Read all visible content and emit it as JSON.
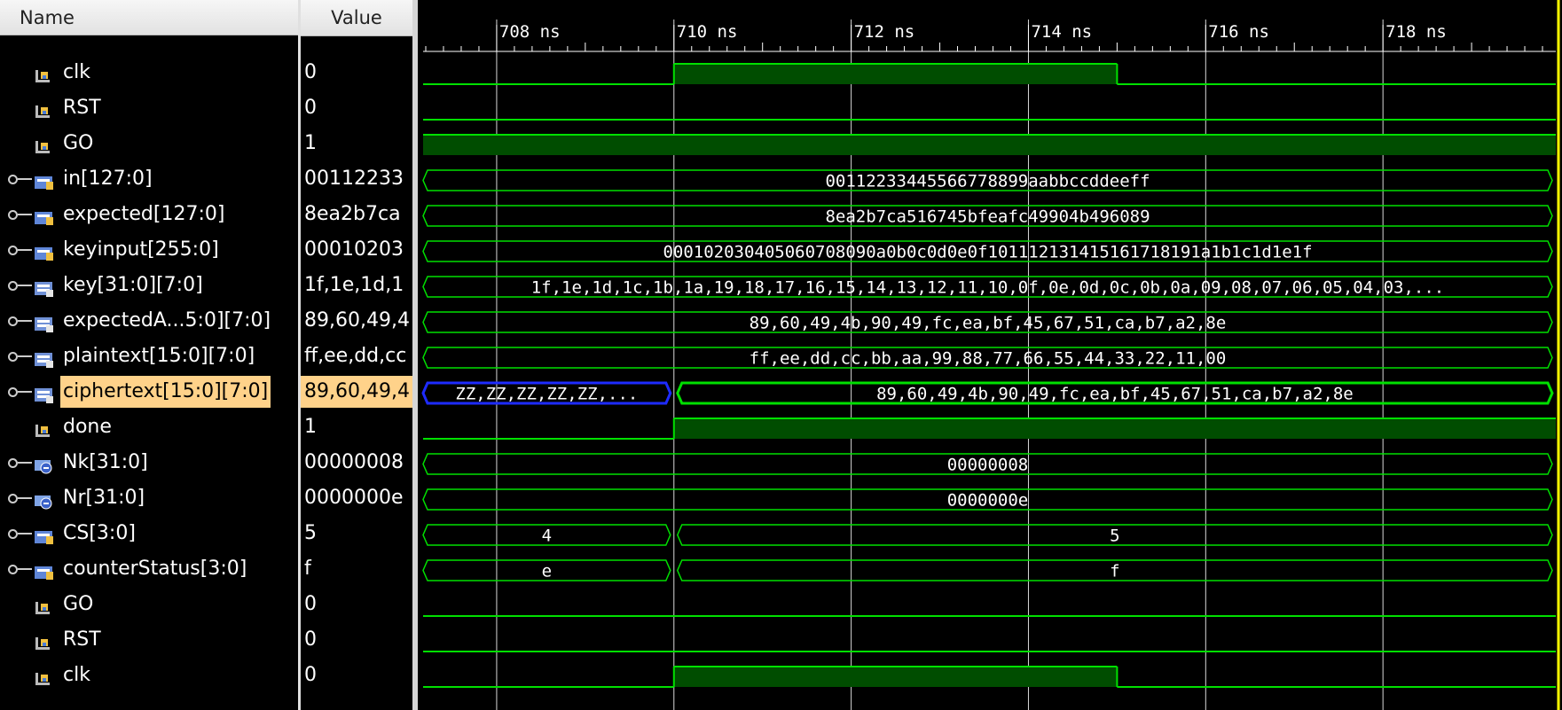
{
  "headers": {
    "name": "Name",
    "value": "Value"
  },
  "time_axis": {
    "ticks": [
      "708 ns",
      "710 ns",
      "712 ns",
      "714 ns",
      "716 ns",
      "718 ns"
    ],
    "tick_times_ns": [
      708,
      710,
      712,
      714,
      716,
      718
    ],
    "view_start_ns": 707.17,
    "view_end_ns": 719.95
  },
  "colors": {
    "trace": "#00e000",
    "fill": "#004d00",
    "trace_unknown": "#1e2bff",
    "cursor": "#ffff00",
    "grid": "#ffffff",
    "selection": "#ffd28a"
  },
  "signals": [
    {
      "name": "clk",
      "value": "0",
      "icon": "bit-signal-icon",
      "kind": "bit",
      "edges": [
        [
          707.17,
          0
        ],
        [
          710,
          1
        ],
        [
          715,
          0
        ]
      ]
    },
    {
      "name": "RST",
      "value": "0",
      "icon": "bit-signal-icon",
      "kind": "bit",
      "edges": [
        [
          707.17,
          0
        ]
      ]
    },
    {
      "name": "GO",
      "value": "1",
      "icon": "bit-signal-icon",
      "kind": "bit",
      "edges": [
        [
          707.17,
          1
        ]
      ]
    },
    {
      "name": "in[127:0]",
      "value": "00112233",
      "icon": "bus-signal-icon",
      "kind": "bus",
      "segments": [
        {
          "from": 707.17,
          "to": 719.95,
          "text": "00112233445566778899aabbccddeeff"
        }
      ]
    },
    {
      "name": "expected[127:0]",
      "value": "8ea2b7ca",
      "icon": "bus-signal-icon",
      "kind": "bus",
      "segments": [
        {
          "from": 707.17,
          "to": 719.95,
          "text": "8ea2b7ca516745bfeafc49904b496089"
        }
      ]
    },
    {
      "name": "keyinput[255:0]",
      "value": "00010203",
      "icon": "bus-signal-icon",
      "kind": "bus",
      "segments": [
        {
          "from": 707.17,
          "to": 719.95,
          "text": "000102030405060708090a0b0c0d0e0f101112131415161718191a1b1c1d1e1f"
        }
      ]
    },
    {
      "name": "key[31:0][7:0]",
      "value": "1f,1e,1d,1",
      "icon": "array-signal-icon",
      "kind": "bus",
      "segments": [
        {
          "from": 707.17,
          "to": 719.95,
          "text": "1f,1e,1d,1c,1b,1a,19,18,17,16,15,14,13,12,11,10,0f,0e,0d,0c,0b,0a,09,08,07,06,05,04,03,..."
        }
      ]
    },
    {
      "name": "expectedA...5:0][7:0]",
      "value": "89,60,49,4",
      "icon": "array-signal-icon",
      "kind": "bus",
      "segments": [
        {
          "from": 707.17,
          "to": 719.95,
          "text": "89,60,49,4b,90,49,fc,ea,bf,45,67,51,ca,b7,a2,8e"
        }
      ]
    },
    {
      "name": "plaintext[15:0][7:0]",
      "value": "ff,ee,dd,cc",
      "icon": "array-signal-icon",
      "kind": "bus",
      "segments": [
        {
          "from": 707.17,
          "to": 719.95,
          "text": "ff,ee,dd,cc,bb,aa,99,88,77,66,55,44,33,22,11,00"
        }
      ]
    },
    {
      "name": "ciphertext[15:0][7:0]",
      "value": "89,60,49,4",
      "icon": "array-signal-icon",
      "kind": "bus",
      "selected": true,
      "segments": [
        {
          "from": 707.17,
          "to": 710,
          "text": "ZZ,ZZ,ZZ,ZZ,ZZ,...",
          "unknown": true
        },
        {
          "from": 710,
          "to": 719.95,
          "text": "89,60,49,4b,90,49,fc,ea,bf,45,67,51,ca,b7,a2,8e"
        }
      ]
    },
    {
      "name": "done",
      "value": "1",
      "icon": "bit-signal-icon",
      "kind": "bit",
      "edges": [
        [
          707.17,
          0
        ],
        [
          710,
          1
        ]
      ]
    },
    {
      "name": "Nk[31:0]",
      "value": "00000008",
      "icon": "parameter-icon",
      "kind": "bus",
      "segments": [
        {
          "from": 707.17,
          "to": 719.95,
          "text": "00000008"
        }
      ]
    },
    {
      "name": "Nr[31:0]",
      "value": "0000000e",
      "icon": "parameter-icon",
      "kind": "bus",
      "segments": [
        {
          "from": 707.17,
          "to": 719.95,
          "text": "0000000e"
        }
      ]
    },
    {
      "name": "CS[3:0]",
      "value": "5",
      "icon": "bus-signal-icon",
      "kind": "bus",
      "segments": [
        {
          "from": 707.17,
          "to": 710,
          "text": "4"
        },
        {
          "from": 710,
          "to": 719.95,
          "text": "5"
        }
      ]
    },
    {
      "name": "counterStatus[3:0]",
      "value": "f",
      "icon": "bus-signal-icon",
      "kind": "bus",
      "segments": [
        {
          "from": 707.17,
          "to": 710,
          "text": "e"
        },
        {
          "from": 710,
          "to": 719.95,
          "text": "f"
        }
      ]
    },
    {
      "name": "GO",
      "value": "0",
      "icon": "bit-signal-icon",
      "kind": "bit",
      "edges": [
        [
          707.17,
          0
        ]
      ]
    },
    {
      "name": "RST",
      "value": "0",
      "icon": "bit-signal-icon",
      "kind": "bit",
      "edges": [
        [
          707.17,
          0
        ]
      ]
    },
    {
      "name": "clk",
      "value": "0",
      "icon": "bit-signal-icon",
      "kind": "bit",
      "edges": [
        [
          707.17,
          0
        ],
        [
          710,
          1
        ],
        [
          715,
          0
        ]
      ]
    }
  ]
}
